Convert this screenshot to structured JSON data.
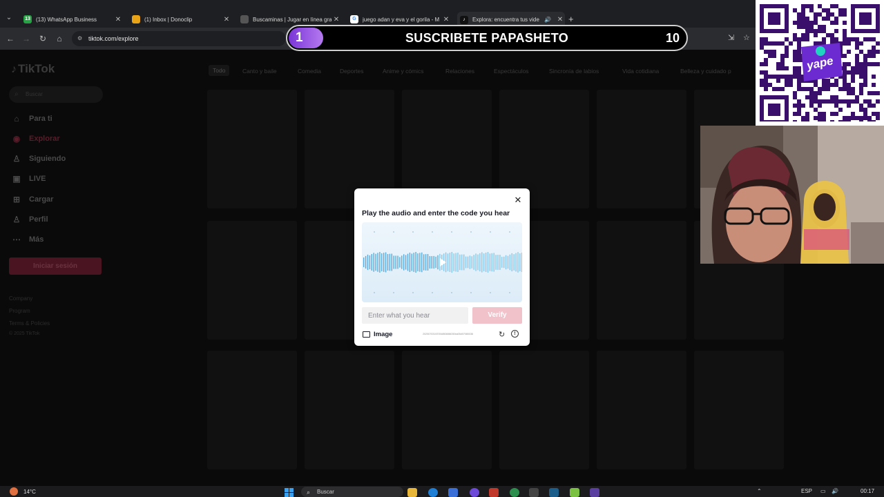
{
  "browser": {
    "tabs": [
      {
        "title": "(13) WhatsApp Business",
        "favicon_color": "#25a244",
        "favicon_glyph": "13",
        "active": false
      },
      {
        "title": "(1) Inbox | Donoclip",
        "favicon_color": "#e8a317",
        "favicon_glyph": "",
        "active": false
      },
      {
        "title": "Buscaminas | Jugar en línea gra",
        "favicon_color": "#555555",
        "favicon_glyph": "",
        "active": false
      },
      {
        "title": "juego adan y eva y el gorila - M",
        "favicon_color": "#4285f4",
        "favicon_glyph": "G",
        "active": false
      },
      {
        "title": "Explora: encuentra tus vide",
        "favicon_color": "#111111",
        "favicon_glyph": "♪",
        "active": true
      }
    ],
    "url": "tiktok.com/explore"
  },
  "overlay": {
    "subscribe_text": "SUSCRIBETE PAPASHETO",
    "count_left": "1",
    "count_right": "10",
    "yape_label": "yape"
  },
  "tiktok": {
    "logo": "TikTok",
    "search_placeholder": "Buscar",
    "nav": [
      {
        "label": "Para ti",
        "icon": "home-icon",
        "active": false
      },
      {
        "label": "Explorar",
        "icon": "compass-icon",
        "active": true
      },
      {
        "label": "Siguiendo",
        "icon": "user-follow-icon",
        "active": false
      },
      {
        "label": "LIVE",
        "icon": "live-icon",
        "active": false
      },
      {
        "label": "Cargar",
        "icon": "upload-icon",
        "active": false
      },
      {
        "label": "Perfil",
        "icon": "profile-icon",
        "active": false
      },
      {
        "label": "Más",
        "icon": "more-icon",
        "active": false
      }
    ],
    "login_label": "Iniciar sesión",
    "footer": [
      "Company",
      "Program",
      "Terms & Policies",
      "© 2025 TikTok"
    ],
    "categories": [
      "Todo",
      "Canto y baile",
      "Comedia",
      "Deportes",
      "Anime y cómics",
      "Relaciones",
      "Espectáculos",
      "Sincronía de labios",
      "Vida cotidiana",
      "Belleza y cuidado p"
    ]
  },
  "captcha": {
    "title": "Play the audio and enter the code you hear",
    "input_placeholder": "Enter what you hear",
    "verify_label": "Verify",
    "image_label": "Image",
    "code_text": "20250703193784850886030ba05d07080036"
  },
  "taskbar": {
    "temperature": "14°C",
    "search_label": "Buscar",
    "language": "ESP",
    "time": "00:17"
  }
}
